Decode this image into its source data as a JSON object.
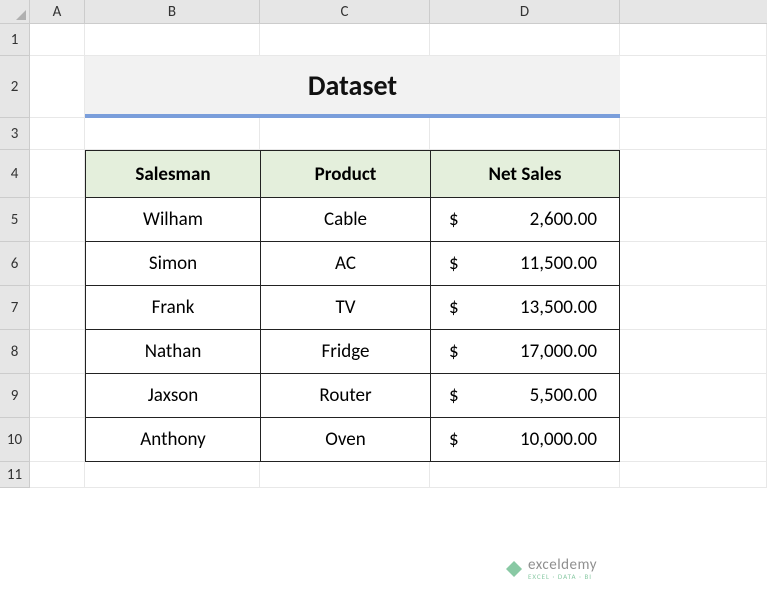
{
  "columns": [
    "A",
    "B",
    "C",
    "D"
  ],
  "rows": [
    "1",
    "2",
    "3",
    "4",
    "5",
    "6",
    "7",
    "8",
    "9",
    "10",
    "11"
  ],
  "title": "Dataset",
  "headers": {
    "salesman": "Salesman",
    "product": "Product",
    "netsales": "Net Sales"
  },
  "currency": "$",
  "data": [
    {
      "salesman": "Wilham",
      "product": "Cable",
      "netsales": "2,600.00"
    },
    {
      "salesman": "Simon",
      "product": "AC",
      "netsales": "11,500.00"
    },
    {
      "salesman": "Frank",
      "product": "TV",
      "netsales": "13,500.00"
    },
    {
      "salesman": "Nathan",
      "product": "Fridge",
      "netsales": "17,000.00"
    },
    {
      "salesman": "Jaxson",
      "product": "Router",
      "netsales": "5,500.00"
    },
    {
      "salesman": "Anthony",
      "product": "Oven",
      "netsales": "10,000.00"
    }
  ],
  "watermark": {
    "main": "exceldemy",
    "sub": "EXCEL · DATA · BI"
  }
}
